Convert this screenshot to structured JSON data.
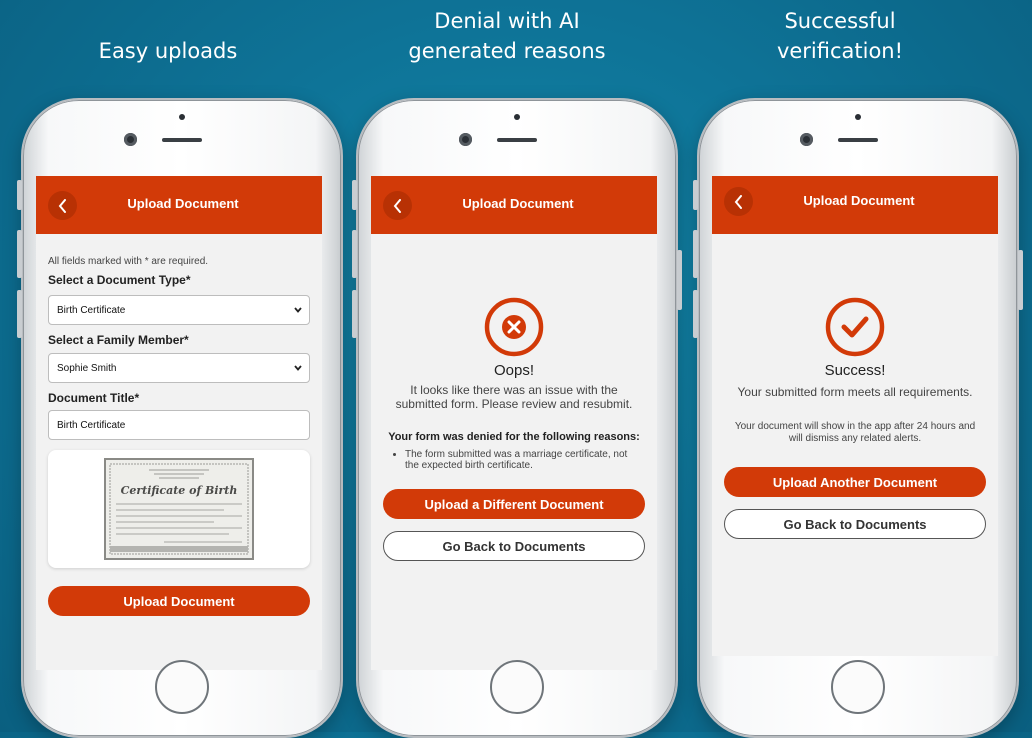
{
  "captions": {
    "left": "Easy uploads",
    "middle_line1": "Denial with AI",
    "middle_line2": "generated reasons",
    "right_line1": "Successful",
    "right_line2": "verification!"
  },
  "colors": {
    "accent": "#d23a08",
    "background": "#0e7397"
  },
  "header": {
    "title": "Upload Document",
    "back_icon": "chevron-left-icon"
  },
  "upload_screen": {
    "required_note": "All fields marked with * are required.",
    "doc_type_label": "Select a Document Type*",
    "doc_type_value": "Birth Certificate",
    "family_label": "Select a Family Member*",
    "family_value": "Sophie Smith",
    "title_label": "Document Title*",
    "title_value": "Birth Certificate",
    "preview_image": "birth-certificate-scan",
    "preview_heading": "Certificate of Birth",
    "submit_label": "Upload Document"
  },
  "denial_screen": {
    "status_icon": "x-circle-icon",
    "heading": "Oops!",
    "message": "It looks like there was an issue with the submitted form. Please review and resubmit.",
    "reasons_heading": "Your form was denied for the following reasons:",
    "reasons": [
      "The form submitted was a marriage certificate, not the expected birth certificate."
    ],
    "primary_label": "Upload a Different Document",
    "secondary_label": "Go Back to Documents"
  },
  "success_screen": {
    "status_icon": "check-circle-icon",
    "heading": "Success!",
    "message": "Your submitted form meets all requirements.",
    "note": "Your document will show in the app after 24 hours and will dismiss any related alerts.",
    "primary_label": "Upload Another Document",
    "secondary_label": "Go Back to Documents"
  }
}
